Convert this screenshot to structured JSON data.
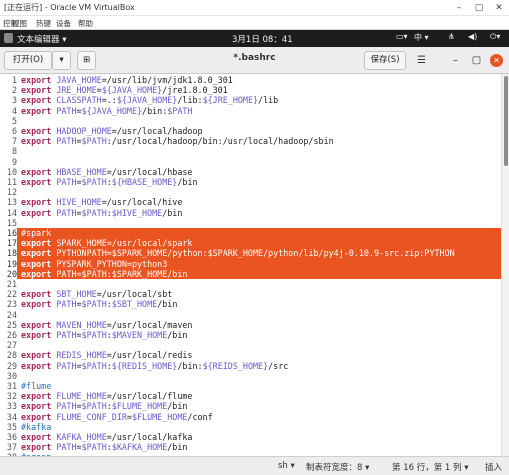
{
  "vbox": {
    "title": "[正在运行] - Oracle VM VirtualBox",
    "menu": [
      "控制",
      "视图",
      "热键",
      "设备",
      "帮助"
    ]
  },
  "topbar": {
    "app_name": "文本编辑器 ▾",
    "clock": "3月1日  08：41",
    "input_method": "中 ▾"
  },
  "headerbar": {
    "open_label": "打开(O)",
    "save_label": "保存(S)",
    "file_title": "*.bashrc"
  },
  "editor": {
    "lines": [
      {
        "n": "1",
        "text": "export JAVA_HOME=/usr/lib/jvm/jdk1.8.0_301"
      },
      {
        "n": "2",
        "text": "export JRE_HOME=${JAVA_HOME}/jre1.8.0_301"
      },
      {
        "n": "3",
        "text": "export CLASSPATH=.:${JAVA_HOME}/lib:${JRE_HOME}/lib"
      },
      {
        "n": "4",
        "text": "export PATH=${JAVA_HOME}/bin:$PATH"
      },
      {
        "n": "5",
        "text": ""
      },
      {
        "n": "6",
        "text": "export HADOOP_HOME=/usr/local/hadoop"
      },
      {
        "n": "7",
        "text": "export PATH=$PATH:/usr/local/hadoop/bin:/usr/local/hadoop/sbin"
      },
      {
        "n": "8",
        "text": ""
      },
      {
        "n": "9",
        "text": ""
      },
      {
        "n": "10",
        "text": "export HBASE_HOME=/usr/local/hbase"
      },
      {
        "n": "11",
        "text": "export PATH=$PATH:${HBASE_HOME}/bin"
      },
      {
        "n": "12",
        "text": ""
      },
      {
        "n": "13",
        "text": "export HIVE_HOME=/usr/local/hive"
      },
      {
        "n": "14",
        "text": "export PATH=$PATH:$HIVE_HOME/bin"
      },
      {
        "n": "15",
        "text": ""
      },
      {
        "n": "16",
        "text": "#spark"
      },
      {
        "n": "17",
        "text": "export SPARK_HOME=/usr/local/spark"
      },
      {
        "n": "18",
        "text": "export PYTHONPATH=$SPARK_HOME/python:$SPARK_HOME/python/lib/py4j-0.10.9-src.zip:PYTHON"
      },
      {
        "n": "19",
        "text": "export PYSPARK_PYTHON=python3"
      },
      {
        "n": "20",
        "text": "export PATH=$PATH:$SPARK_HOME/bin"
      },
      {
        "n": "21",
        "text": ""
      },
      {
        "n": "22",
        "text": "export SBT_HOME=/usr/local/sbt"
      },
      {
        "n": "23",
        "text": "export PATH=$PATH:$SBT_HOME/bin"
      },
      {
        "n": "24",
        "text": ""
      },
      {
        "n": "25",
        "text": "export MAVEN_HOME=/usr/local/maven"
      },
      {
        "n": "26",
        "text": "export PATH=$PATH:$MAVEN_HOME/bin"
      },
      {
        "n": "27",
        "text": ""
      },
      {
        "n": "28",
        "text": "export REDIS_HOME=/usr/local/redis"
      },
      {
        "n": "29",
        "text": "export PATH=$PATH:${REDIS_HOME}/bin:${REIDS_HOME}/src"
      },
      {
        "n": "30",
        "text": ""
      },
      {
        "n": "31",
        "text": "#flume"
      },
      {
        "n": "32",
        "text": "export FLUME_HOME=/usr/local/flume"
      },
      {
        "n": "33",
        "text": "export PATH=$PATH:$FLUME_HOME/bin"
      },
      {
        "n": "34",
        "text": "export FLUME_CONF_DIR=$FLUME_HOME/conf"
      },
      {
        "n": "35",
        "text": "#kafka"
      },
      {
        "n": "36",
        "text": "export KAFKA_HOME=/usr/local/kafka"
      },
      {
        "n": "37",
        "text": "export PATH=$PATH:$KAFKA_HOME/bin"
      },
      {
        "n": "38",
        "text": "#sqoop"
      }
    ],
    "selected_lines": [
      "16",
      "17",
      "18",
      "19",
      "20"
    ]
  },
  "statusbar": {
    "language": "sh ▾",
    "tab_width": "制表符宽度：8 ▾",
    "cursor": "第 16 行，第 1 列 ▾",
    "mode": "插入"
  },
  "colors": {
    "selection": "#e95420",
    "keyword": "#a52a5a",
    "variable": "#6a5acd",
    "comment": "#2a6fb5"
  }
}
